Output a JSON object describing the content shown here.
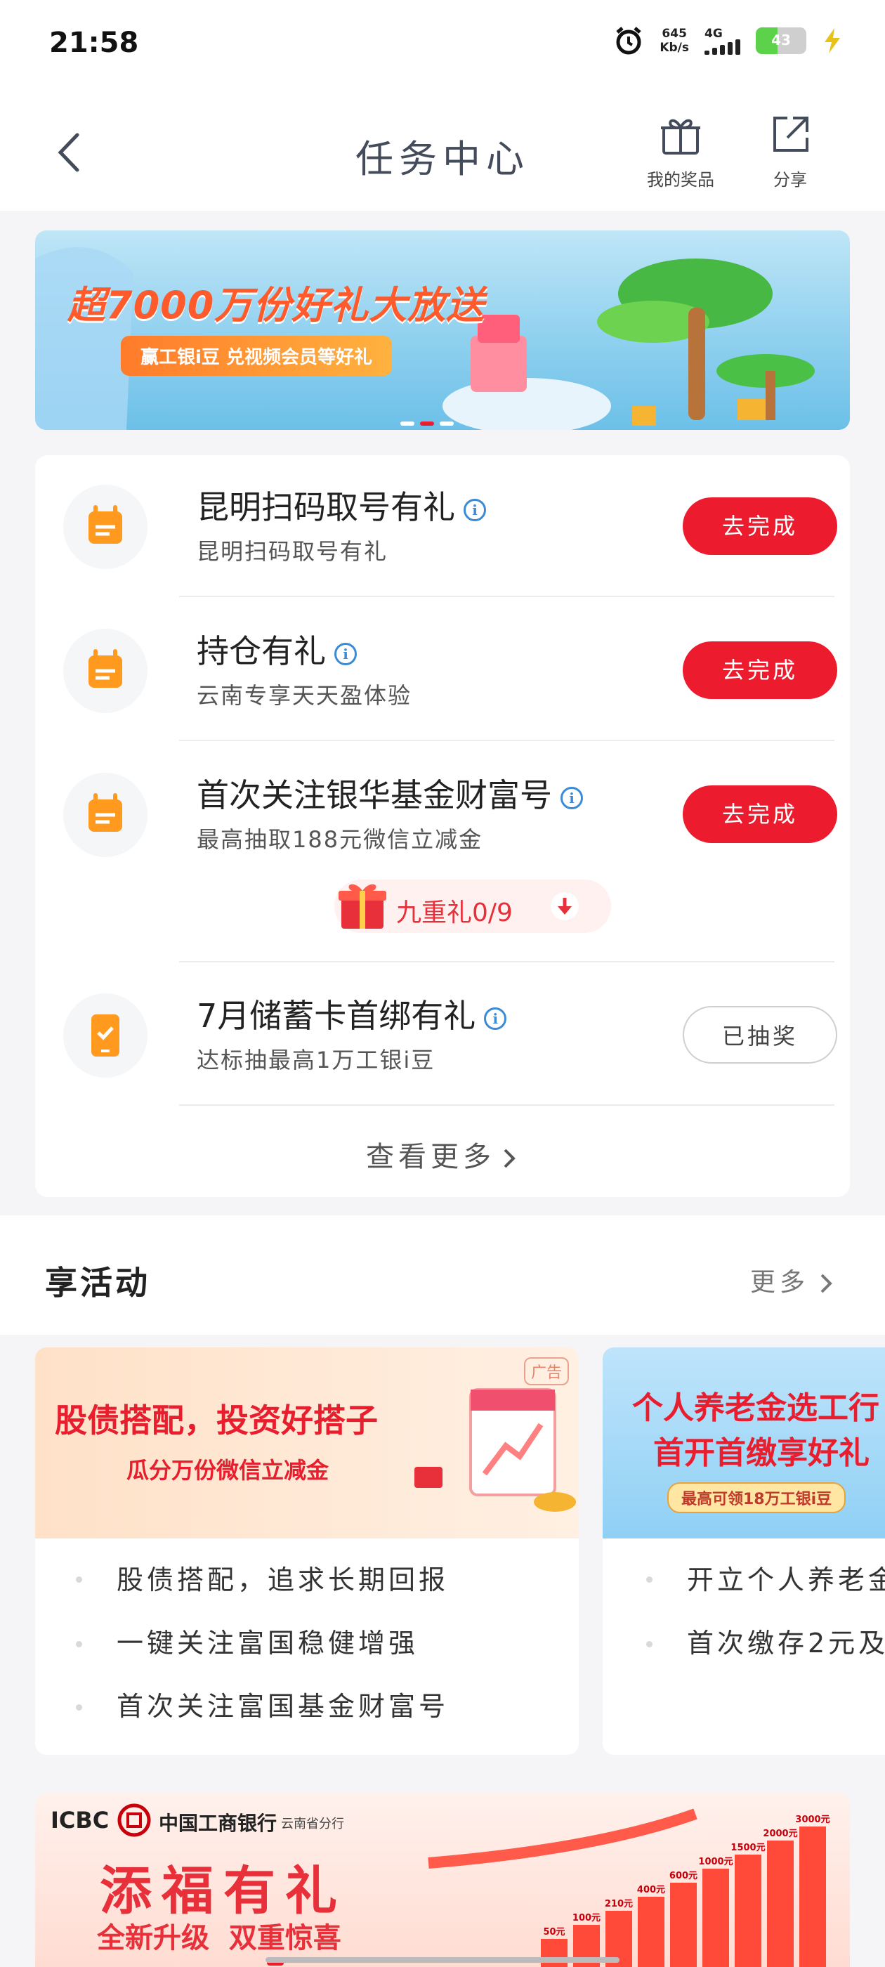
{
  "status_bar": {
    "time": "21:58",
    "speed": "645",
    "speed_unit": "Kb/s",
    "network": "4G",
    "battery": "43",
    "battery_fill_percent": 43
  },
  "header": {
    "title": "任务中心",
    "prizes_label": "我的奖品",
    "share_label": "分享"
  },
  "banner": {
    "headline": "超7000万份好礼大放送",
    "sub": "赢工银i豆 兑视频会员等好礼"
  },
  "tasks": [
    {
      "title": "昆明扫码取号有礼",
      "desc": "昆明扫码取号有礼",
      "button": "去完成"
    },
    {
      "title": "持仓有礼",
      "desc": "云南专享天天盈体验",
      "button": "去完成"
    },
    {
      "title": "首次关注银华基金财富号",
      "desc": "最高抽取188元微信立减金",
      "button": "去完成",
      "gift_label": "九重礼0/9"
    },
    {
      "title": "7月储蓄卡首绑有礼",
      "desc": "达标抽最高1万工银i豆",
      "button": "已抽奖"
    }
  ],
  "view_more": "查看更多",
  "activities": {
    "title": "享活动",
    "more": "更多",
    "cards": [
      {
        "headline": "股债搭配，投资好搭子",
        "sub": "瓜分万份微信立减金",
        "ad": "广告",
        "items": [
          "股债搭配，追求长期回报",
          "一键关注富国稳健增强",
          "首次关注富国基金财富号"
        ]
      },
      {
        "headline": "个人养老金选工行",
        "sub": "首开首缴享好礼",
        "badge": "最高可领18万工银i豆",
        "items": [
          "开立个人养老金",
          "首次缴存2元及"
        ]
      }
    ]
  },
  "promo": {
    "bank": "中国工商银行",
    "branch": "云南省分行",
    "brand": "ICBC",
    "headline": "添福有礼",
    "sub": "全新升级  双重惊喜",
    "steps": [
      "50元",
      "100元",
      "210元",
      "400元",
      "600元",
      "1000元",
      "1500元",
      "2000元",
      "3000元"
    ]
  },
  "colors": {
    "accent": "#ec1c2e",
    "link": "#3a8bd6",
    "task_icon": "#ff9a1f"
  }
}
